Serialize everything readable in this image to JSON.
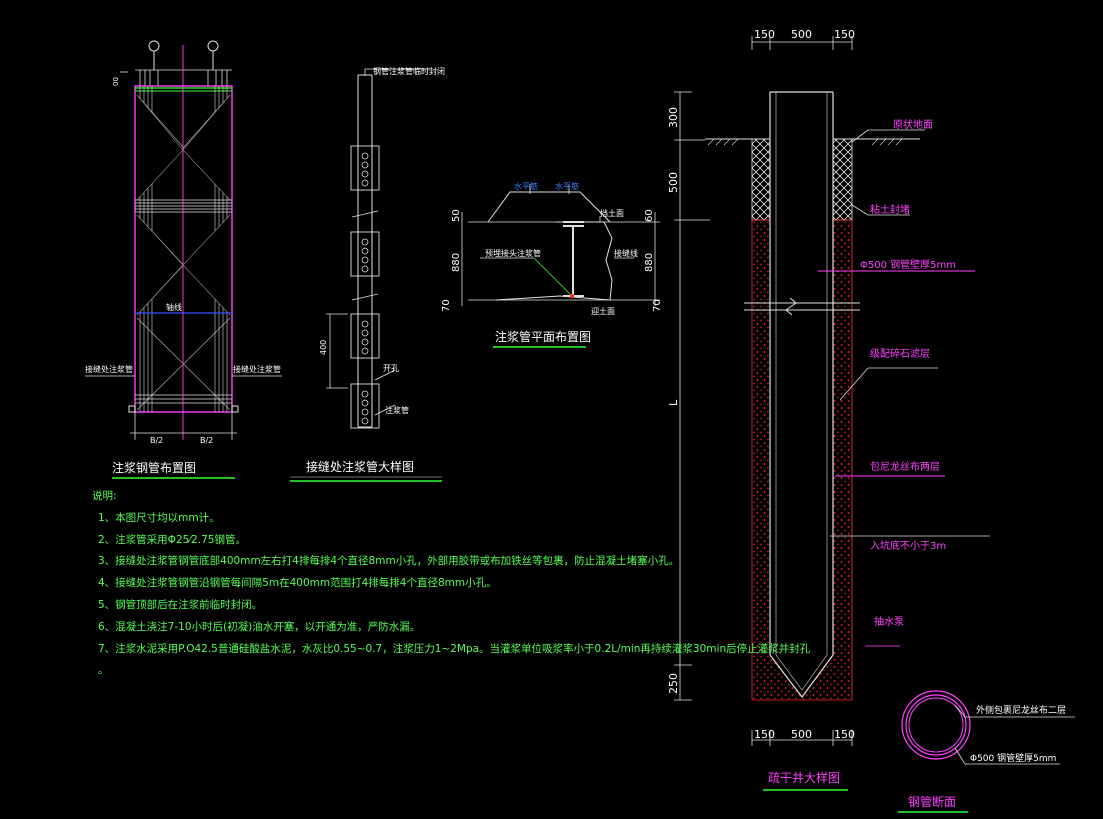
{
  "titles": {
    "grout_pipe_layout": "注浆钢管布置图",
    "joint_detail": "接缝处注浆管大样图",
    "grout_plan": "注浆管平面布置图",
    "well_detail": "疏干井大样图",
    "pipe_section": "钢管断面"
  },
  "layout": {
    "label_left": "接缝处注浆管",
    "label_right": "接缝处注浆管",
    "label_center": "轴线",
    "dim_left": "B/2",
    "dim_right": "B/2",
    "top_mark": "00"
  },
  "joint": {
    "top_label": "钢管注浆管临时封闭",
    "hole_label": "开孔",
    "pipe_label": "注浆管",
    "dim_label": "400"
  },
  "plan": {
    "waterstop_1": "水平筋",
    "waterstop_2": "水平筋",
    "soil_top": "挡土面",
    "grout_pipe": "预埋接头注浆管",
    "joint": "接缝线",
    "soil_bottom": "迎土面",
    "dim_50_left": "50",
    "dim_880_left": "880",
    "dim_70_left": "70",
    "dim_60_right": "60",
    "dim_880_right": "880",
    "dim_70_right": "70"
  },
  "well": {
    "dims_top": [
      "150",
      "500",
      "150"
    ],
    "dims_bottom": [
      "150",
      "500",
      "150"
    ],
    "dims_left": [
      "300",
      "500",
      "L",
      "250"
    ],
    "original_ground": "原状地面",
    "clay_seal": "粘土封堵",
    "steel_pipe": "Φ500 钢管壁厚5mm",
    "gravel_filter": "级配碎石滤层",
    "nylon_mesh": "包尼龙丝布两层",
    "embed_depth": "入坑底不小于3m",
    "pump": "抽水泵"
  },
  "section": {
    "outer_wrap": "外侧包裹尼龙丝布二层",
    "pipe_spec": "Φ500 钢管壁厚5mm"
  },
  "notes": {
    "heading": "说明:",
    "items": [
      "1、本图尺寸均以mm计。",
      "2、注浆管采用Φ25⁄2.75钢管。",
      "3、接缝处注浆管钢管底部400mm左右打4排每排4个直径8mm小孔，外部用胶带或布加铁丝等包裹，防止混凝土堵塞小孔。",
      "4、接缝处注浆管钢管沿钢管每间隔5m在400mm范围打4排每排4个直径8mm小孔。",
      "5、钢管顶部后在注浆前临时封闭。",
      "6、混凝土浇注7-10小时后(初凝)油水开塞，以开通为准，严防水漏。",
      "7、注浆水泥采用P.O42.5普通硅酸盐水泥，水灰比0.55~0.7，注浆压力1~2Mpa。当灌浆单位吸浆率小于0.2L/min再持续灌浆30min后停止灌浆并封孔",
      "。"
    ]
  },
  "colors": {
    "background": "#000000",
    "line": "#e0e0e0",
    "magenta": "#ff40ff",
    "green": "#33ff33",
    "red": "#ff2a2a",
    "blue": "#3c7cff"
  }
}
